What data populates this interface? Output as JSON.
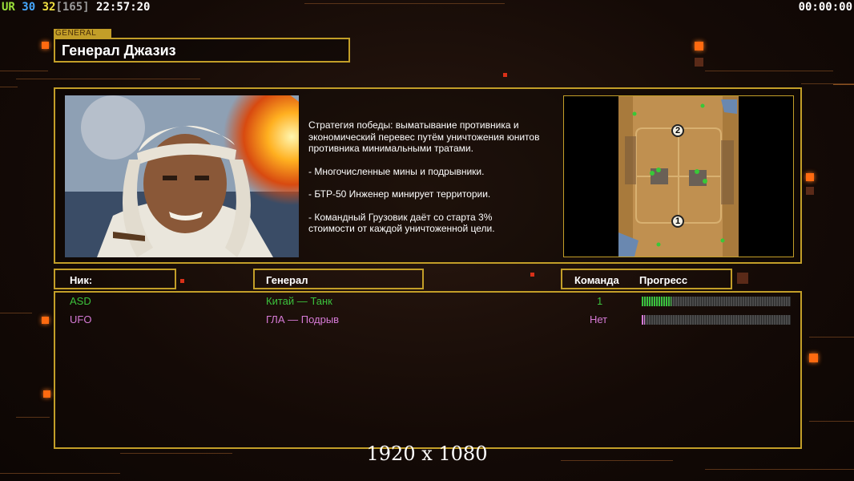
{
  "overlay": {
    "mode": "UR",
    "fps": "30",
    "fps_cap": "32",
    "frame_count": "[165]",
    "clock": "22:57:20",
    "timer": "00:00:00"
  },
  "general": {
    "tag": "GENERAL",
    "name": "Генерал Джазиз",
    "strategy": "Стратегия победы: выматывание противника и\n экономический перевес путём уничтожения юнитов\n противника минимальными тратами.",
    "features": [
      "- Многочисленные мины и подрывники.",
      "- БТР-50 Инженер минирует территории.",
      "- Командный Грузовик даёт со старта 3%\n стоимости от каждой уничтоженной цели."
    ]
  },
  "map": {
    "start_positions": [
      "2",
      "1"
    ]
  },
  "table": {
    "headers": {
      "nick": "Ник:",
      "general": "Генерал",
      "team": "Команда",
      "progress": "Прогресс"
    },
    "players": [
      {
        "nick": "ASD",
        "general": "Китай — Танк",
        "team": "1",
        "progress": 0.2,
        "color": "#3cc23c"
      },
      {
        "nick": "UFO",
        "general": "ГЛА — Подрыв",
        "team": "Нет",
        "progress": 0.02,
        "color": "#d67ad6"
      }
    ]
  },
  "resolution_label": "1920 x 1080",
  "colors": {
    "accent": "#c29e28",
    "glow": "#ff6a10"
  }
}
